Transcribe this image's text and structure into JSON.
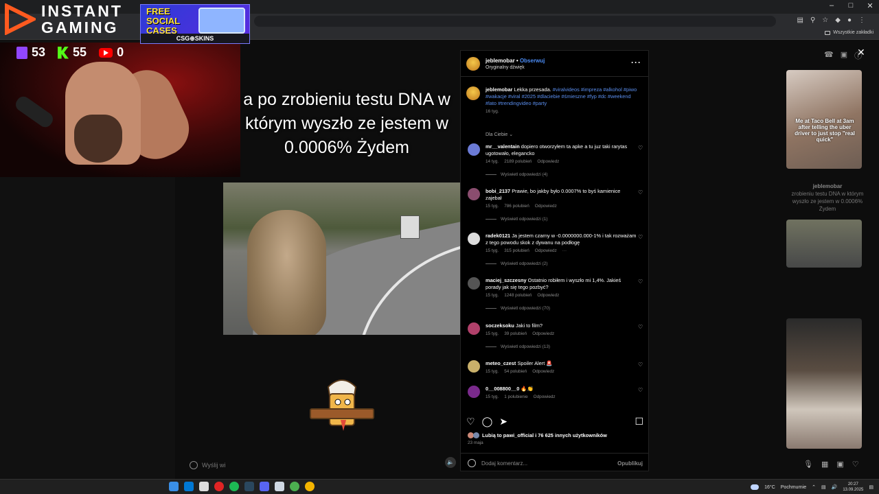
{
  "stream": {
    "logo_text_line1": "INSTANT",
    "logo_text_line2": "GAMING",
    "banner_line1": "FREE",
    "banner_line2": "SOCIAL",
    "banner_line3": "CASES",
    "banner_footer": "CSG⊕SKINS",
    "twitch_count": "53",
    "kick_count": "55",
    "youtube_count": "0"
  },
  "browser": {
    "bookmarks_label": "Wszystkie zakładki"
  },
  "video": {
    "caption": "a po zrobieniu testu DNA w którym wyszło ze jestem w 0.0006% Żydem",
    "reply_placeholder": "Wyślij wi"
  },
  "post": {
    "username": "jeblemobar",
    "follow": "Obserwuj",
    "audio": "Oryginalny dźwięk",
    "caption_user": "jeblemobar",
    "caption_text": "Lekka przesada.",
    "caption_tags": "#viralvideos #impreza #alkohol #piwo #wakacje #viral #2025 #dlaciebie #śmieszne #fyp #dc #weekend #lato #trendingvideo #party",
    "caption_time": "16 tyg.",
    "sort_label": "Dla Ciebie",
    "comments": [
      {
        "user": "mr__valentain",
        "text": "dopiero otworzyłem ta apke a tu juz taki rarytas ugotowało, elegancko",
        "time": "14 tyg.",
        "likes": "2189 polubień",
        "reply": "Odpowiedz",
        "view_replies": "Wyświetl odpowiedzi (4)",
        "color": "#6b7bd6"
      },
      {
        "user": "bobi_2137",
        "text": "Prawie, bo jakby było 0.0007% to byś kamienice zajebał",
        "time": "15 tyg.",
        "likes": "786 polubień",
        "reply": "Odpowiedz",
        "view_replies": "Wyświetl odpowiedzi (1)",
        "color": "#8a4d6f"
      },
      {
        "user": "radek0121",
        "text": "Ja jestem czarny w -0.0000000.000-1% i tak rozważam z tego powodu skok z dywanu na podłogę",
        "time": "15 tyg.",
        "likes": "315 polubień",
        "reply": "Odpowiedz",
        "more": "···",
        "view_replies": "Wyświetl odpowiedzi (2)",
        "color": "#dcdcdc"
      },
      {
        "user": "maciej_szczesny",
        "text": "Ostatnio robiłem i wyszło mi 1,4%. Jakieś porady jak się tego pozbyć?",
        "time": "15 tyg.",
        "likes": "1248 polubień",
        "reply": "Odpowiedz",
        "view_replies": "Wyświetl odpowiedzi (70)",
        "color": "#555"
      },
      {
        "user": "soczeksoku",
        "text": "Jaki to film?",
        "time": "15 tyg.",
        "likes": "39 polubień",
        "reply": "Odpowiedz",
        "view_replies": "Wyświetl odpowiedzi (13)",
        "color": "#b0406a"
      },
      {
        "user": "meteo_czest",
        "text": "Spoiler Alert 🚨",
        "time": "15 tyg.",
        "likes": "54 polubień",
        "reply": "Odpowiedz",
        "color": "#c9b06a"
      },
      {
        "user": "0__008800__0",
        "text": "🔥👏",
        "time": "15 tyg.",
        "likes": "1 polubienie",
        "reply": "Odpowiedz",
        "color": "#7a2a8c"
      }
    ],
    "likes_text": "Lubią to pawi_official i 76 625 innych użytkowników",
    "date": "23 maja",
    "comment_placeholder": "Dodaj komentarz...",
    "publish": "Opublikuj"
  },
  "side": {
    "thumb1_text": "Me at Taco Bell at 3am after telling the uber driver to just stop \"real quick\"",
    "ghost_user": "jeblemobar",
    "ghost_caption": "zrobieniu testu DNA w którym wyszło ze jestem w 0.0006% Żydem"
  },
  "taskbar": {
    "temperature": "16°C",
    "weather": "Pochmurnie",
    "time": "20:27",
    "date": "13.09.2025"
  },
  "colors": {
    "link_blue": "#4c8df6",
    "twitch": "#9146ff",
    "kick": "#53fc18",
    "youtube": "#ff0000"
  }
}
